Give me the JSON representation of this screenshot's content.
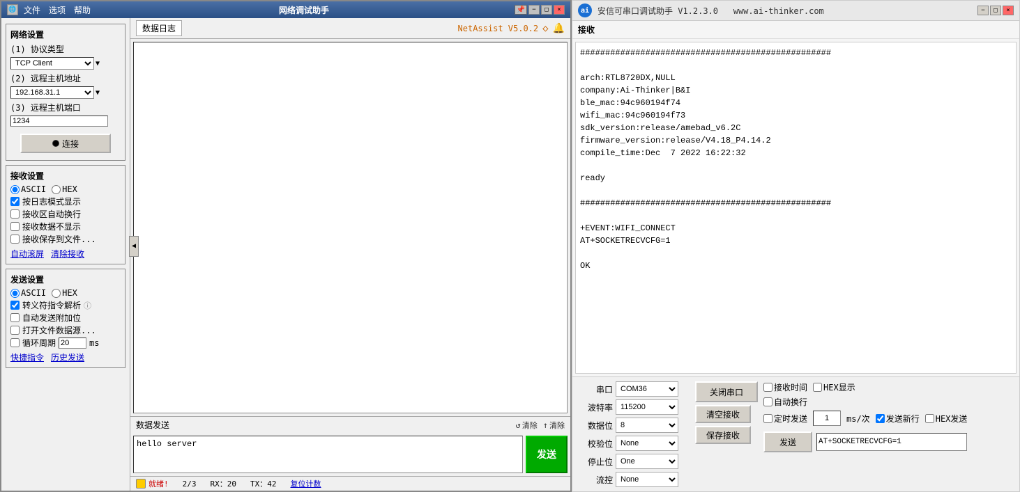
{
  "left_window": {
    "title": "网络调试助手",
    "menu_items": [
      "文件",
      "选项",
      "帮助"
    ],
    "title_controls": [
      "−",
      "□",
      "×"
    ],
    "network_settings": {
      "section_title": "网络设置",
      "protocol_label": "(1) 协议类型",
      "protocol_value": "TCP Client",
      "remote_host_label": "(2) 远程主机地址",
      "remote_host_value": "192.168.31.1",
      "remote_port_label": "(3) 远程主机端口",
      "remote_port_value": "1234",
      "connect_btn": "连接"
    },
    "receive_settings": {
      "section_title": "接收设置",
      "ascii_label": "ASCII",
      "hex_label": "HEX",
      "log_mode": "按日志模式显示",
      "auto_wrap": "接收区自动换行",
      "no_display": "接收数据不显示",
      "save_to_file": "接收保存到文件...",
      "auto_scroll": "自动滚屏",
      "clear_recv": "清除接收"
    },
    "send_settings": {
      "section_title": "发送设置",
      "ascii_label": "ASCII",
      "hex_label": "HEX",
      "escape_parse": "转义符指令解析",
      "auto_add_bit": "自动发送附加位",
      "open_file": "打开文件数据源...",
      "loop_period": "循环周期",
      "loop_ms": "20",
      "loop_unit": "ms",
      "quick_cmd": "快捷指令",
      "history_send": "历史发送"
    },
    "data_log": {
      "tab_label": "数据日志",
      "version": "NetAssist V5.0.2",
      "log_content": ""
    },
    "data_send": {
      "header": "数据发送",
      "clear1": "清除",
      "clear2": "清除",
      "send_btn": "发送",
      "send_content": "hello server"
    },
    "status_bar": {
      "status_text": "就绪!",
      "progress": "2/3",
      "rx": "RX：20",
      "tx": "TX：42",
      "reset_count": "复位计数"
    }
  },
  "right_window": {
    "title": "安信可串口调试助手 V1.2.3.0",
    "website": "www.ai-thinker.com",
    "receive_label": "接收",
    "receive_content": "##################################################\n\narch:RTL8720DX,NULL\ncompany:Ai-Thinker|B&I\nble_mac:94c960194f74\nwifi_mac:94c960194f73\nsdk_version:release/amebad_v6.2C\nfirmware_version:release/V4.18_P4.14.2\ncompile_time:Dec  7 2022 16:22:32\n\nready\n\n##################################################\n\n+EVENT:WIFI_CONNECT\nAT+SOCKETRECVCFG=1\n\nOK",
    "port_settings": {
      "port_label": "串口",
      "port_value": "COM36",
      "baud_label": "波特率",
      "baud_value": "115200",
      "data_bits_label": "数据位",
      "data_bits_value": "8",
      "parity_label": "校验位",
      "parity_value": "None",
      "stop_bits_label": "停止位",
      "stop_bits_value": "One",
      "flow_ctrl_label": "流控",
      "flow_ctrl_value": "None"
    },
    "buttons": {
      "open_port": "关闭串口",
      "clear_recv": "清空接收",
      "save_recv": "保存接收",
      "send_btn": "发送"
    },
    "options": {
      "recv_time": "接收时间",
      "hex_display": "HEX显示",
      "auto_wrap": "自动换行",
      "timing_send": "定时发送",
      "timing_ms": "1",
      "timing_unit": "ms/次",
      "send_newline": "发送新行",
      "hex_send": "HEX发送"
    },
    "send_content": "AT+SOCKETRECVCFG=1"
  }
}
